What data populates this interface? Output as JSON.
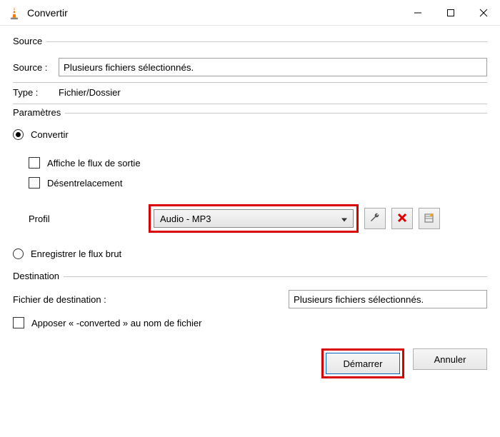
{
  "window": {
    "title": "Convertir"
  },
  "source": {
    "group_title": "Source",
    "label": "Source :",
    "value": "Plusieurs fichiers sélectionnés.",
    "type_label": "Type :",
    "type_value": "Fichier/Dossier"
  },
  "settings": {
    "group_title": "Paramètres",
    "convert_label": "Convertir",
    "show_output_label": "Affiche le flux de sortie",
    "deinterlace_label": "Désentrelacement",
    "profile_label": "Profil",
    "profile_selected": "Audio - MP3",
    "raw_label": "Enregistrer le flux brut"
  },
  "destination": {
    "group_title": "Destination",
    "file_label": "Fichier de destination :",
    "file_value": "Plusieurs fichiers sélectionnés.",
    "append_label": "Apposer « -converted » au nom de fichier"
  },
  "buttons": {
    "start": "Démarrer",
    "cancel": "Annuler"
  },
  "icons": {
    "wrench": "wrench-icon",
    "delete": "delete-icon",
    "new": "new-profile-icon"
  }
}
